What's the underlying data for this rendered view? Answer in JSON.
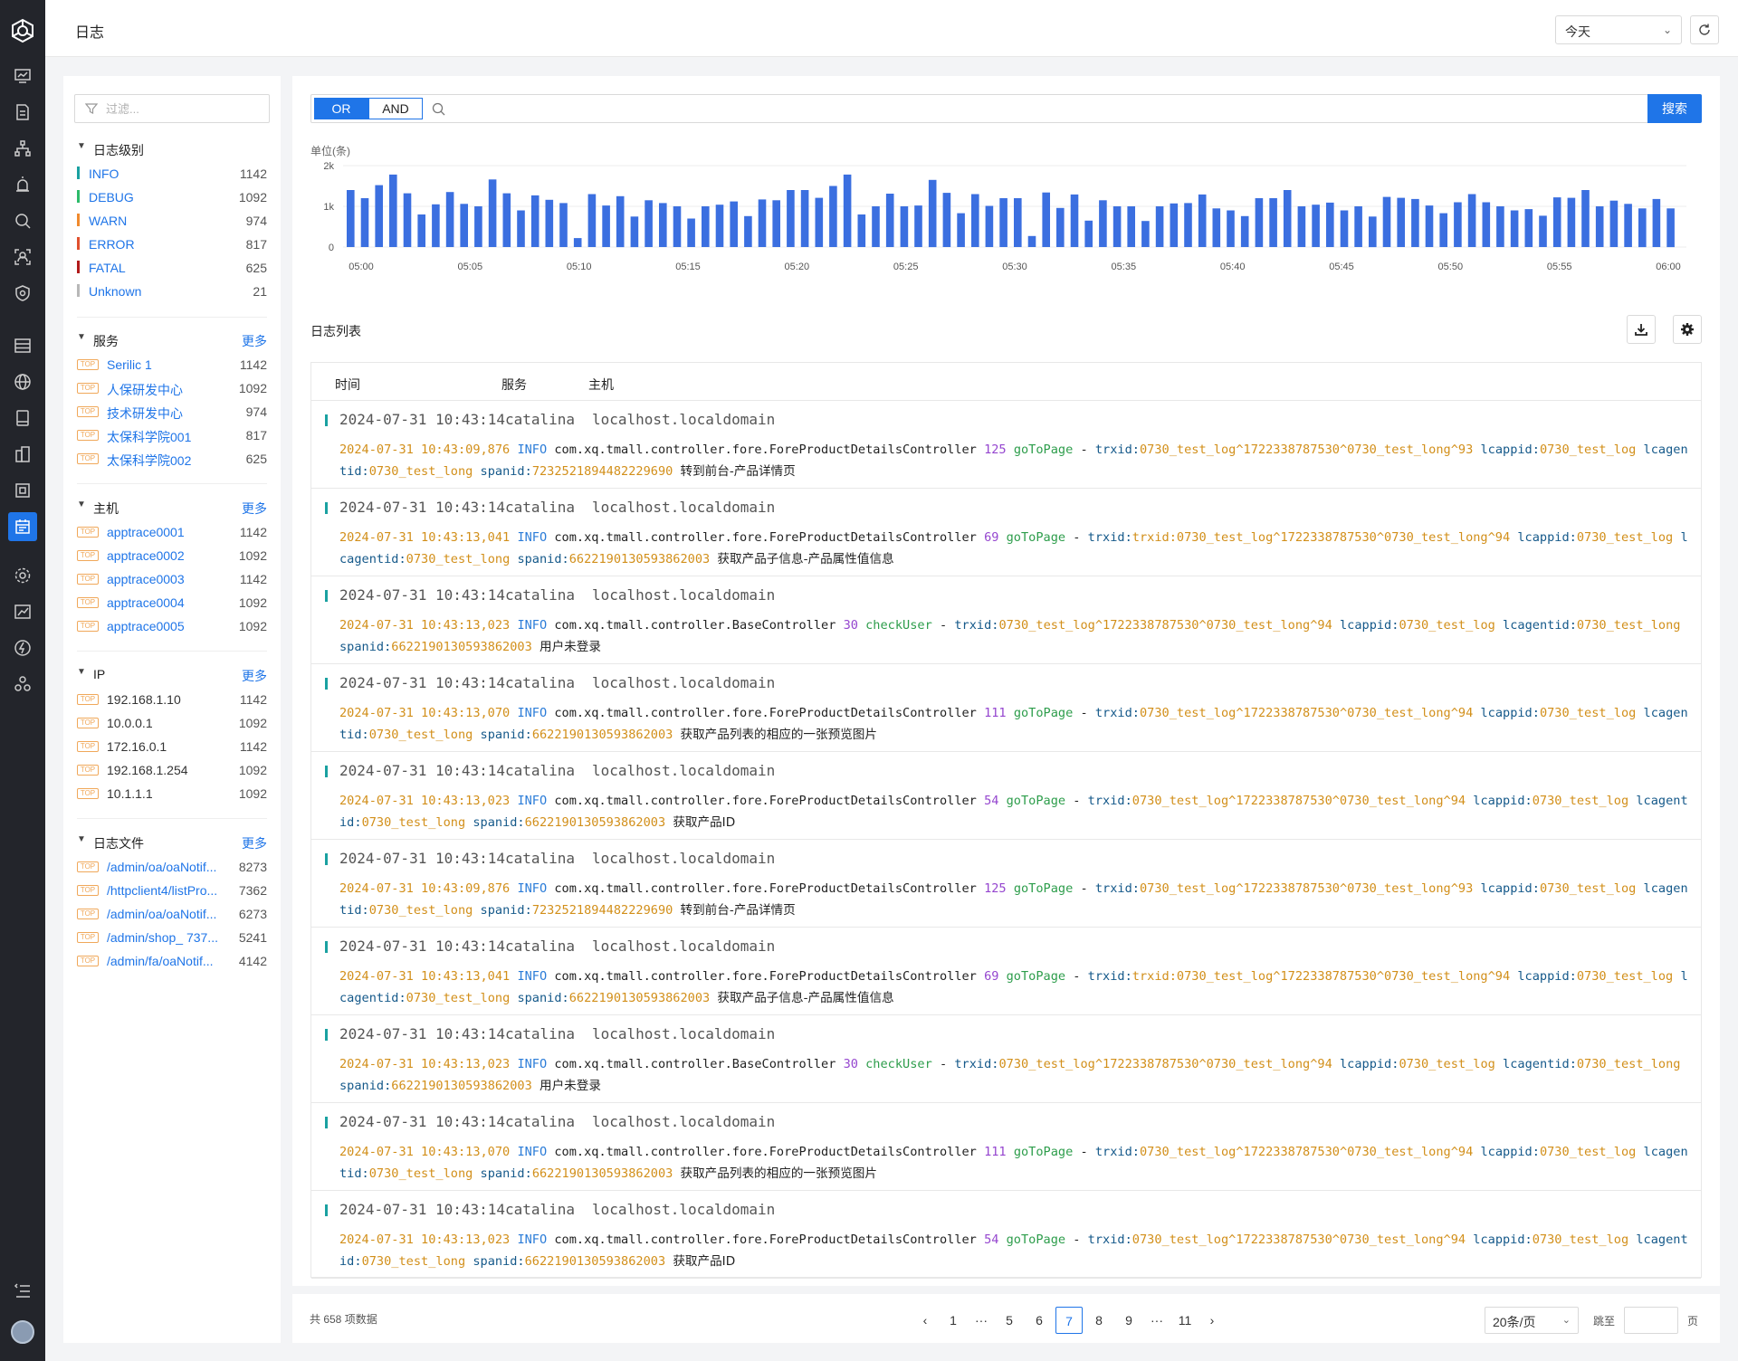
{
  "header": {
    "title": "日志",
    "time_range": "今天"
  },
  "sidebar": {
    "filter_placeholder": "过滤...",
    "levels": {
      "title": "日志级别",
      "items": [
        {
          "label": "INFO",
          "count": "1142",
          "color": "#1aa1a1"
        },
        {
          "label": "DEBUG",
          "count": "1092",
          "color": "#2dbb6a"
        },
        {
          "label": "WARN",
          "count": "974",
          "color": "#f08a2e"
        },
        {
          "label": "ERROR",
          "count": "817",
          "color": "#e0502e"
        },
        {
          "label": "FATAL",
          "count": "625",
          "color": "#b11b1b"
        },
        {
          "label": "Unknown",
          "count": "21",
          "color": "#b8b8b8"
        }
      ]
    },
    "services": {
      "title": "服务",
      "more": "更多",
      "items": [
        {
          "label": "Serilic 1",
          "count": "1142"
        },
        {
          "label": "人保研发中心",
          "count": "1092"
        },
        {
          "label": "技术研发中心",
          "count": "974"
        },
        {
          "label": "太保科学院001",
          "count": "817"
        },
        {
          "label": "太保科学院002",
          "count": "625"
        }
      ]
    },
    "hosts": {
      "title": "主机",
      "more": "更多",
      "items": [
        {
          "label": "apptrace0001",
          "count": "1142"
        },
        {
          "label": "apptrace0002",
          "count": "1092"
        },
        {
          "label": "apptrace0003",
          "count": "1142"
        },
        {
          "label": "apptrace0004",
          "count": "1092"
        },
        {
          "label": "apptrace0005",
          "count": "1092"
        }
      ]
    },
    "ips": {
      "title": "IP",
      "more": "更多",
      "items": [
        {
          "label": "192.168.1.10",
          "count": "1142"
        },
        {
          "label": "10.0.0.1",
          "count": "1092"
        },
        {
          "label": "172.16.0.1",
          "count": "1142"
        },
        {
          "label": "192.168.1.254",
          "count": "1092"
        },
        {
          "label": "10.1.1.1",
          "count": "1092"
        }
      ]
    },
    "files": {
      "title": "日志文件",
      "more": "更多",
      "items": [
        {
          "label": "/admin/oa/oaNotif...",
          "count": "8273"
        },
        {
          "label": "/httpclient4/listPro...",
          "count": "7362"
        },
        {
          "label": "/admin/oa/oaNotif...",
          "count": "6273"
        },
        {
          "label": "/admin/shop_ 737...",
          "count": "5241"
        },
        {
          "label": "/admin/fa/oaNotif...",
          "count": "4142"
        }
      ]
    },
    "top_tag": "TOP"
  },
  "query": {
    "or_label": "OR",
    "and_label": "AND",
    "search_label": "搜索"
  },
  "chart_data": {
    "type": "bar",
    "unit_label": "单位(条)",
    "ylim": [
      0,
      2000
    ],
    "y_ticks": [
      "0",
      "1k",
      "2k"
    ],
    "x_ticks": [
      "05:00",
      "05:05",
      "05:10",
      "05:15",
      "05:20",
      "05:25",
      "05:30",
      "05:35",
      "05:40",
      "05:45",
      "05:50",
      "05:55",
      "06:00"
    ],
    "color": "#3b6fe0",
    "values": [
      1400,
      1200,
      1520,
      1780,
      1320,
      800,
      1050,
      1350,
      1060,
      1000,
      1660,
      1320,
      900,
      1270,
      1160,
      1080,
      220,
      1300,
      1020,
      1250,
      750,
      1150,
      1080,
      1000,
      700,
      1000,
      1040,
      1120,
      760,
      1170,
      1150,
      1400,
      1400,
      1210,
      1500,
      1780,
      800,
      1000,
      1310,
      1000,
      1020,
      1650,
      1330,
      830,
      1300,
      1010,
      1200,
      1200,
      270,
      1340,
      960,
      1290,
      650,
      1150,
      1000,
      1000,
      640,
      1000,
      1070,
      1080,
      1290,
      950,
      900,
      760,
      1200,
      1200,
      1400,
      1000,
      1040,
      1090,
      900,
      1000,
      750,
      1230,
      1210,
      1180,
      1020,
      830,
      1100,
      1300,
      1100,
      1000,
      900,
      930,
      770,
      1220,
      1210,
      1400,
      1000,
      1140,
      1060,
      950,
      1180,
      950
    ]
  },
  "log_list": {
    "title": "日志列表",
    "columns": [
      "时间",
      "服务",
      "主机"
    ],
    "rows": [
      {
        "time": "2024-07-31 10:43:14",
        "service": "catalina",
        "host": "localhost.localdomain",
        "ts": "2024-07-31 10:43:09,876",
        "level": "INFO",
        "cls": "com.xq.tmall.controller.fore.ForeProductDetailsController",
        "line": "125",
        "method": "goToPage",
        "dash": "-",
        "trxid_key": "trxid:",
        "trxid": "0730_test_log^1722338787530^0730_test_long^93",
        "appid_key": "lcappid:",
        "appid": "0730_test_log",
        "agent_key": "lcagentid:",
        "agent": "0730_test_long",
        "span_key": "spanid:",
        "span": "7232521894482229690",
        "msg": "转到前台-产品详情页"
      },
      {
        "time": "2024-07-31 10:43:14",
        "service": "catalina",
        "host": "localhost.localdomain",
        "ts": "2024-07-31 10:43:13,041",
        "level": "INFO",
        "cls": "com.xq.tmall.controller.fore.ForeProductDetailsController",
        "line": "69",
        "method": "goToPage",
        "dash": "-",
        "trxid_key": "trxid:",
        "trxid": "trxid:0730_test_log^1722338787530^0730_test_long^94",
        "appid_key": "lcappid:",
        "appid": "0730_test_log",
        "agent_key": "lcagentid:",
        "agent": "0730_test_long",
        "span_key": "spanid:",
        "span": "6622190130593862003",
        "msg": "获取产品子信息-产品属性值信息"
      },
      {
        "time": "2024-07-31 10:43:14",
        "service": "catalina",
        "host": "localhost.localdomain",
        "ts": "2024-07-31 10:43:13,023",
        "level": "INFO",
        "cls": "com.xq.tmall.controller.BaseController",
        "line": "30",
        "method": "checkUser",
        "dash": "-",
        "trxid_key": "trxid:",
        "trxid": "0730_test_log^1722338787530^0730_test_long^94",
        "appid_key": "lcappid:",
        "appid": "0730_test_log",
        "agent_key": "lcagentid:",
        "agent": "0730_test_long",
        "span_key": "spanid:",
        "span": "6622190130593862003",
        "msg": "用户未登录"
      },
      {
        "time": "2024-07-31 10:43:14",
        "service": "catalina",
        "host": "localhost.localdomain",
        "ts": "2024-07-31 10:43:13,070",
        "level": "INFO",
        "cls": "com.xq.tmall.controller.fore.ForeProductDetailsController",
        "line": "111",
        "method": "goToPage",
        "dash": "-",
        "trxid_key": "trxid:",
        "trxid": "0730_test_log^1722338787530^0730_test_long^94",
        "appid_key": "lcappid:",
        "appid": "0730_test_log",
        "agent_key": "lcagentid:",
        "agent": "0730_test_long",
        "span_key": "spanid:",
        "span": "6622190130593862003",
        "msg": "获取产品列表的相应的一张预览图片"
      },
      {
        "time": "2024-07-31 10:43:14",
        "service": "catalina",
        "host": "localhost.localdomain",
        "ts": "2024-07-31 10:43:13,023",
        "level": "INFO",
        "cls": "com.xq.tmall.controller.fore.ForeProductDetailsController",
        "line": "54",
        "method": "goToPage",
        "dash": "-",
        "trxid_key": "trxid:",
        "trxid": "0730_test_log^1722338787530^0730_test_long^94",
        "appid_key": "lcappid:",
        "appid": "0730_test_log",
        "agent_key": "lcagentid:",
        "agent": "0730_test_long",
        "span_key": "spanid:",
        "span": "6622190130593862003",
        "msg": "获取产品ID"
      },
      {
        "time": "2024-07-31 10:43:14",
        "service": "catalina",
        "host": "localhost.localdomain",
        "ts": "2024-07-31 10:43:09,876",
        "level": "INFO",
        "cls": "com.xq.tmall.controller.fore.ForeProductDetailsController",
        "line": "125",
        "method": "goToPage",
        "dash": "-",
        "trxid_key": "trxid:",
        "trxid": "0730_test_log^1722338787530^0730_test_long^93",
        "appid_key": "lcappid:",
        "appid": "0730_test_log",
        "agent_key": "lcagentid:",
        "agent": "0730_test_long",
        "span_key": "spanid:",
        "span": "7232521894482229690",
        "msg": "转到前台-产品详情页"
      },
      {
        "time": "2024-07-31 10:43:14",
        "service": "catalina",
        "host": "localhost.localdomain",
        "ts": "2024-07-31 10:43:13,041",
        "level": "INFO",
        "cls": "com.xq.tmall.controller.fore.ForeProductDetailsController",
        "line": "69",
        "method": "goToPage",
        "dash": "-",
        "trxid_key": "trxid:",
        "trxid": "trxid:0730_test_log^1722338787530^0730_test_long^94",
        "appid_key": "lcappid:",
        "appid": "0730_test_log",
        "agent_key": "lcagentid:",
        "agent": "0730_test_long",
        "span_key": "spanid:",
        "span": "6622190130593862003",
        "msg": "获取产品子信息-产品属性值信息"
      },
      {
        "time": "2024-07-31 10:43:14",
        "service": "catalina",
        "host": "localhost.localdomain",
        "ts": "2024-07-31 10:43:13,023",
        "level": "INFO",
        "cls": "com.xq.tmall.controller.BaseController",
        "line": "30",
        "method": "checkUser",
        "dash": "-",
        "trxid_key": "trxid:",
        "trxid": "0730_test_log^1722338787530^0730_test_long^94",
        "appid_key": "lcappid:",
        "appid": "0730_test_log",
        "agent_key": "lcagentid:",
        "agent": "0730_test_long",
        "span_key": "spanid:",
        "span": "6622190130593862003",
        "msg": "用户未登录"
      },
      {
        "time": "2024-07-31 10:43:14",
        "service": "catalina",
        "host": "localhost.localdomain",
        "ts": "2024-07-31 10:43:13,070",
        "level": "INFO",
        "cls": "com.xq.tmall.controller.fore.ForeProductDetailsController",
        "line": "111",
        "method": "goToPage",
        "dash": "-",
        "trxid_key": "trxid:",
        "trxid": "0730_test_log^1722338787530^0730_test_long^94",
        "appid_key": "lcappid:",
        "appid": "0730_test_log",
        "agent_key": "lcagentid:",
        "agent": "0730_test_long",
        "span_key": "spanid:",
        "span": "6622190130593862003",
        "msg": "获取产品列表的相应的一张预览图片"
      },
      {
        "time": "2024-07-31 10:43:14",
        "service": "catalina",
        "host": "localhost.localdomain",
        "ts": "2024-07-31 10:43:13,023",
        "level": "INFO",
        "cls": "com.xq.tmall.controller.fore.ForeProductDetailsController",
        "line": "54",
        "method": "goToPage",
        "dash": "-",
        "trxid_key": "trxid:",
        "trxid": "0730_test_log^1722338787530^0730_test_long^94",
        "appid_key": "lcappid:",
        "appid": "0730_test_log",
        "agent_key": "lcagentid:",
        "agent": "0730_test_long",
        "span_key": "spanid:",
        "span": "6622190130593862003",
        "msg": "获取产品ID"
      }
    ]
  },
  "pagination": {
    "total": "共 658 项数据",
    "prev": "‹",
    "next": "›",
    "pages": [
      "1",
      "···",
      "5",
      "6",
      "7",
      "8",
      "9",
      "···",
      "11"
    ],
    "current": "7",
    "page_size": "20条/页",
    "jump_label": "跳至",
    "page_suffix": "页"
  }
}
